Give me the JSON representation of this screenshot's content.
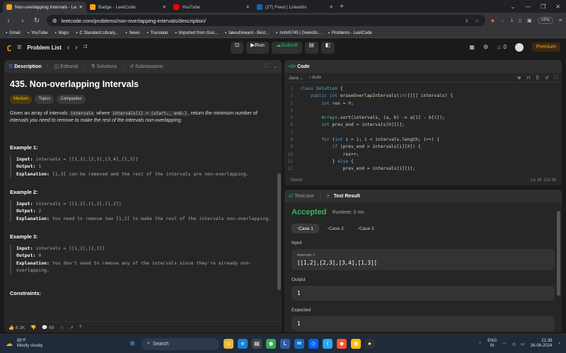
{
  "tabs": [
    {
      "title": "Non-overlapping Intervals - Lee",
      "color": "#ffa116",
      "active": true
    },
    {
      "title": "Badge - LeetCode",
      "color": "#ffa116",
      "active": false
    },
    {
      "title": "YouTube",
      "color": "#ff0000",
      "active": false
    },
    {
      "title": "(27) Feed | LinkedIn",
      "color": "#0a66c2",
      "active": false
    }
  ],
  "url": "leetcode.com/problems/non-overlapping-intervals/description/",
  "vpn": "VPN",
  "bookmarks": [
    "Gmail",
    "YouTube",
    "Maps",
    "C Standard Library...",
    "News",
    "Translate",
    "Imported from Goo...",
    "takeuforward - Best...",
    "rishirh745 | Geeksfo...",
    "Problems - LeetCode"
  ],
  "lc": {
    "problem_list": "Problem List",
    "run": "Run",
    "submit": "Submit",
    "streak": "0",
    "premium": "Premium"
  },
  "desc_tabs": [
    "Description",
    "Editorial",
    "Solutions",
    "Submissions"
  ],
  "problem": {
    "title": "435. Non-overlapping Intervals",
    "tags": [
      "Medium",
      "Topics",
      "Companies"
    ],
    "text_a": "Given an array of intervals ",
    "code_a": "intervals",
    "text_b": " where ",
    "code_b": "intervals[i] = [startᵢ, endᵢ]",
    "text_c": ", return ",
    "text_d": "the minimum number of intervals you need to remove to make the rest of the intervals non-overlapping."
  },
  "examples": [
    {
      "title": "Example 1:",
      "input": "intervals = [[1,2],[2,3],[3,4],[1,3]]",
      "output": "1",
      "explanation": "[1,3] can be removed and the rest of the intervals are non-overlapping."
    },
    {
      "title": "Example 2:",
      "input": "intervals = [[1,2],[1,2],[1,2]]",
      "output": "2",
      "explanation": "You need to remove two [1,2] to make the rest of the intervals non-overlapping."
    },
    {
      "title": "Example 3:",
      "input": "intervals = [[1,2],[2,3]]",
      "output": "0",
      "explanation": "You don't need to remove any of the intervals since they're already non-overlapping."
    }
  ],
  "labels": {
    "input": "Input:",
    "output": "Output:",
    "explanation": "Explanation:",
    "constraints": "Constraints:"
  },
  "footer": {
    "likes": "8.1K",
    "comments": "69"
  },
  "code_panel": {
    "title": "Code",
    "lang": "Java",
    "auto": "Auto",
    "saved": "Saved",
    "cursor": "Ln 16, Col 28"
  },
  "code_lines": [
    "class Solution {",
    "    public int eraseOverlapIntervals(int[][] intervals) {",
    "        int res = 0;",
    "",
    "        Arrays.sort(intervals, (a, b) -> a[1] - b[1]);",
    "        int prev_end = intervals[0][1];",
    "",
    "        for (int i = 1; i < intervals.length; i++) {",
    "            if (prev_end > intervals[i][0]) {",
    "                res++;",
    "            } else {",
    "                prev_end = intervals[i][1];"
  ],
  "result": {
    "tab_testcase": "Testcase",
    "tab_result": "Test Result",
    "status": "Accepted",
    "runtime": "Runtime: 0 ms",
    "cases": [
      "Case 1",
      "Case 2",
      "Case 3"
    ],
    "input_label": "Input",
    "param": "intervals =",
    "input_value": "[[1,2],[2,3],[3,4],[1,3]]",
    "output_label": "Output",
    "output_value": "1",
    "expected_label": "Expected",
    "expected_value": "1"
  },
  "taskbar": {
    "temp": "85°F",
    "weather": "Mostly cloudy",
    "search": "Search",
    "lang1": "ENG",
    "lang2": "IN",
    "time": "21:39",
    "date": "26-06-2024"
  }
}
